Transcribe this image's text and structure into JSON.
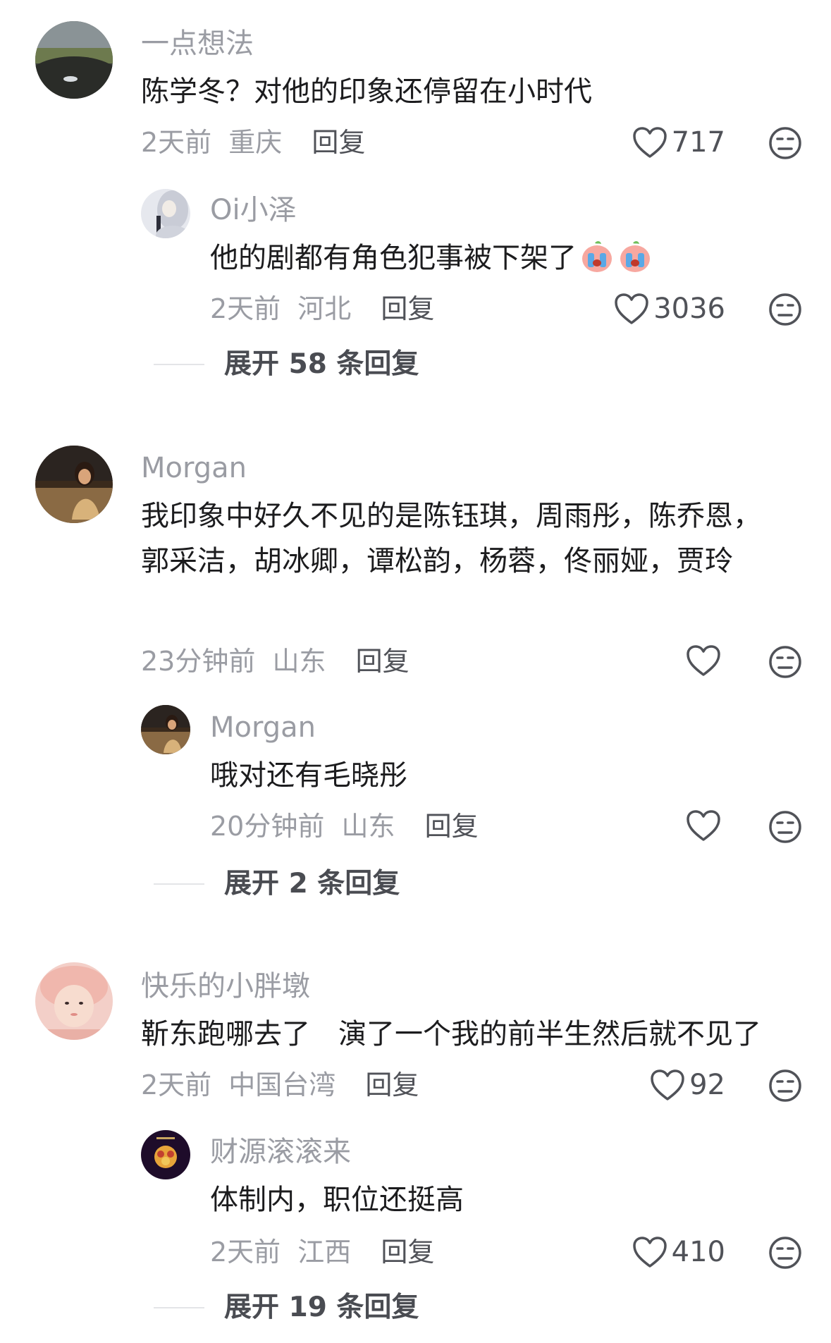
{
  "comments": [
    {
      "username": "一点想法",
      "text": "陈学冬？对他的印象还停留在小时代",
      "time": "2天前",
      "location": "重庆",
      "reply_label": "回复",
      "likes": "717",
      "replies": [
        {
          "username": "Oi小泽",
          "text": "他的剧都有角色犯事被下架了",
          "emoji": [
            "crying-face-emoji",
            "crying-face-emoji"
          ],
          "time": "2天前",
          "location": "河北",
          "reply_label": "回复",
          "likes": "3036"
        }
      ],
      "expand_label": "展开 58 条回复"
    },
    {
      "username": "Morgan",
      "text": "我印象中好久不见的是陈钰琪，周雨彤，陈乔恩，郭采洁，胡冰卿，谭松韵，杨蓉，佟丽娅，贾玲",
      "time": "23分钟前",
      "location": "山东",
      "reply_label": "回复",
      "likes": "",
      "replies": [
        {
          "username": "Morgan",
          "text": "哦对还有毛晓彤",
          "time": "20分钟前",
          "location": "山东",
          "reply_label": "回复",
          "likes": ""
        }
      ],
      "expand_label": "展开 2 条回复"
    },
    {
      "username": "快乐的小胖墩",
      "text": "靳东跑哪去了　演了一个我的前半生然后就不见了",
      "time": "2天前",
      "location": "中国台湾",
      "reply_label": "回复",
      "likes": "92",
      "replies": [
        {
          "username": "财源滚滚来",
          "text": "体制内，职位还挺高",
          "time": "2天前",
          "location": "江西",
          "reply_label": "回复",
          "likes": "410"
        }
      ],
      "expand_label": "展开 19 条回复"
    }
  ],
  "icons": {
    "like": "heart-outline-icon",
    "dislike": "unamused-face-icon"
  },
  "colors": {
    "name": "#9a9ca3",
    "text": "#1c1c1e",
    "meta": "#9a9ca3",
    "reply": "#505258"
  }
}
